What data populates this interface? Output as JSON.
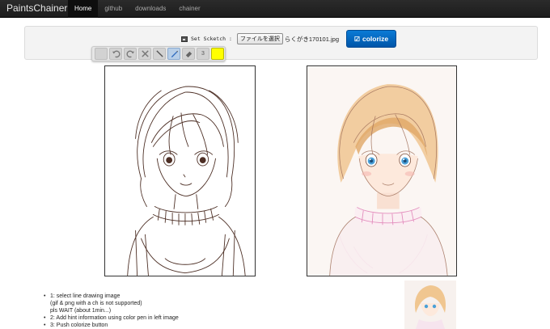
{
  "navbar": {
    "brand": "PaintsChainer",
    "items": [
      {
        "label": "Home",
        "active": true
      },
      {
        "label": "github",
        "active": false
      },
      {
        "label": "downloads",
        "active": false
      },
      {
        "label": "chainer",
        "active": false
      }
    ]
  },
  "upload": {
    "label": "Set Scketch :",
    "file_button": "ファイルを選択",
    "file_name": "らくがき170101.jpg"
  },
  "colorize_button": "colorize",
  "pen_tools": {
    "items": [
      "blank",
      "undo",
      "redo",
      "clear",
      "line",
      "pen",
      "eraser",
      "size",
      "color"
    ],
    "active": "pen",
    "size_value": "3",
    "color": "#ffff00"
  },
  "instructions": [
    "1: select line drawing image",
    "(gif & png with a ch is not supported)",
    "pls WAIT (about 1min...)",
    "2: Add hint information using color pen in left image",
    "3: Push colorize button"
  ],
  "colors": {
    "accent": "#0a6fc9",
    "navbar": "#1f1f1f",
    "line_art": "#5a3a2e",
    "hair": "#e8b878",
    "eyes": "#4aa0d8",
    "sweater_hint": "#d48ac0"
  }
}
